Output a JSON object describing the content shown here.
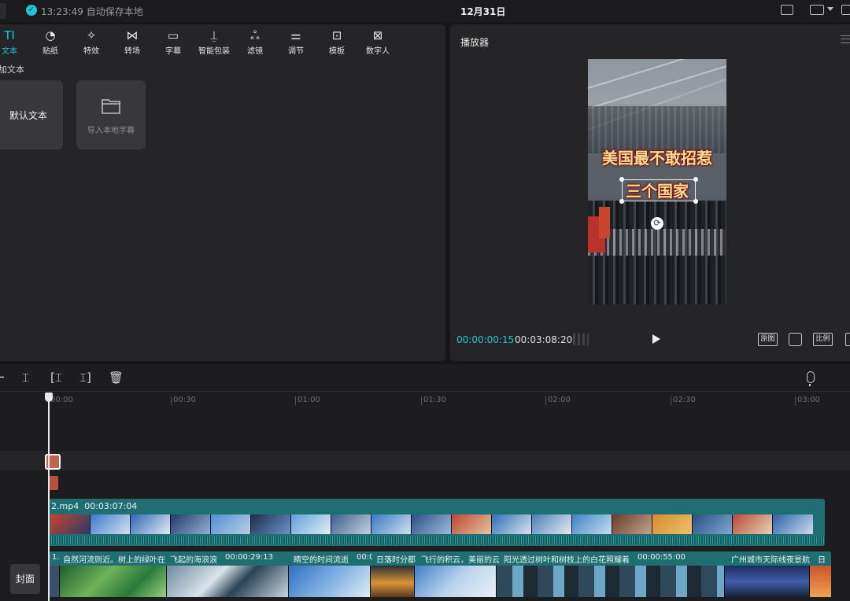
{
  "titlebar": {
    "save_status": "13:23:49 自动保存本地",
    "project_title": "12月31日"
  },
  "toolbar": {
    "tabs": [
      {
        "icon": "text-icon",
        "label": "文本",
        "active": true
      },
      {
        "icon": "sticker-icon",
        "label": "贴纸"
      },
      {
        "icon": "effects-icon",
        "label": "特效"
      },
      {
        "icon": "transition-icon",
        "label": "转场"
      },
      {
        "icon": "subtitle-icon",
        "label": "字幕"
      },
      {
        "icon": "smart-package-icon",
        "label": "智能包装"
      },
      {
        "icon": "filter-icon",
        "label": "滤镜"
      },
      {
        "icon": "adjust-icon",
        "label": "调节"
      },
      {
        "icon": "template-icon",
        "label": "模板"
      },
      {
        "icon": "digital-human-icon",
        "label": "数字人"
      }
    ]
  },
  "media": {
    "section_heading": "添加文本",
    "cards": [
      {
        "label": "默认文本"
      },
      {
        "label": "导入本地字幕",
        "icon": "folder-icon"
      }
    ]
  },
  "player": {
    "title": "播放器",
    "overlay_line1": "美国最不敢招惹",
    "overlay_line2": "三个国家",
    "current_time": "00:00:00:15",
    "total_time": "00:03:08:20",
    "buttons": {
      "original": "原图",
      "ratio": "比例"
    }
  },
  "timeline": {
    "ruler_labels": [
      "00:00",
      "00:30",
      "01:00",
      "01:30",
      "02:00",
      "02:30",
      "03:00"
    ],
    "main_track": {
      "file_name": "2.mp4",
      "duration": "00:03:07:04"
    },
    "broll_labels": [
      "1.",
      "自然河流则近。树上的绿叶在",
      "飞起的海浪浪",
      "00:00:29:13",
      "睛空的时间流逝",
      "00:0",
      "日落时分都",
      "飞行的积云，美丽的云",
      "阳光透过树叶和树枝上的白花照耀着",
      "00:00:55:00",
      "广州城市天际线夜景航",
      "日"
    ],
    "cover_label": "封面"
  },
  "colors": {
    "accent": "#22c5d2",
    "clip_track": "#1f6f72",
    "text_clip": "#b7513f"
  }
}
